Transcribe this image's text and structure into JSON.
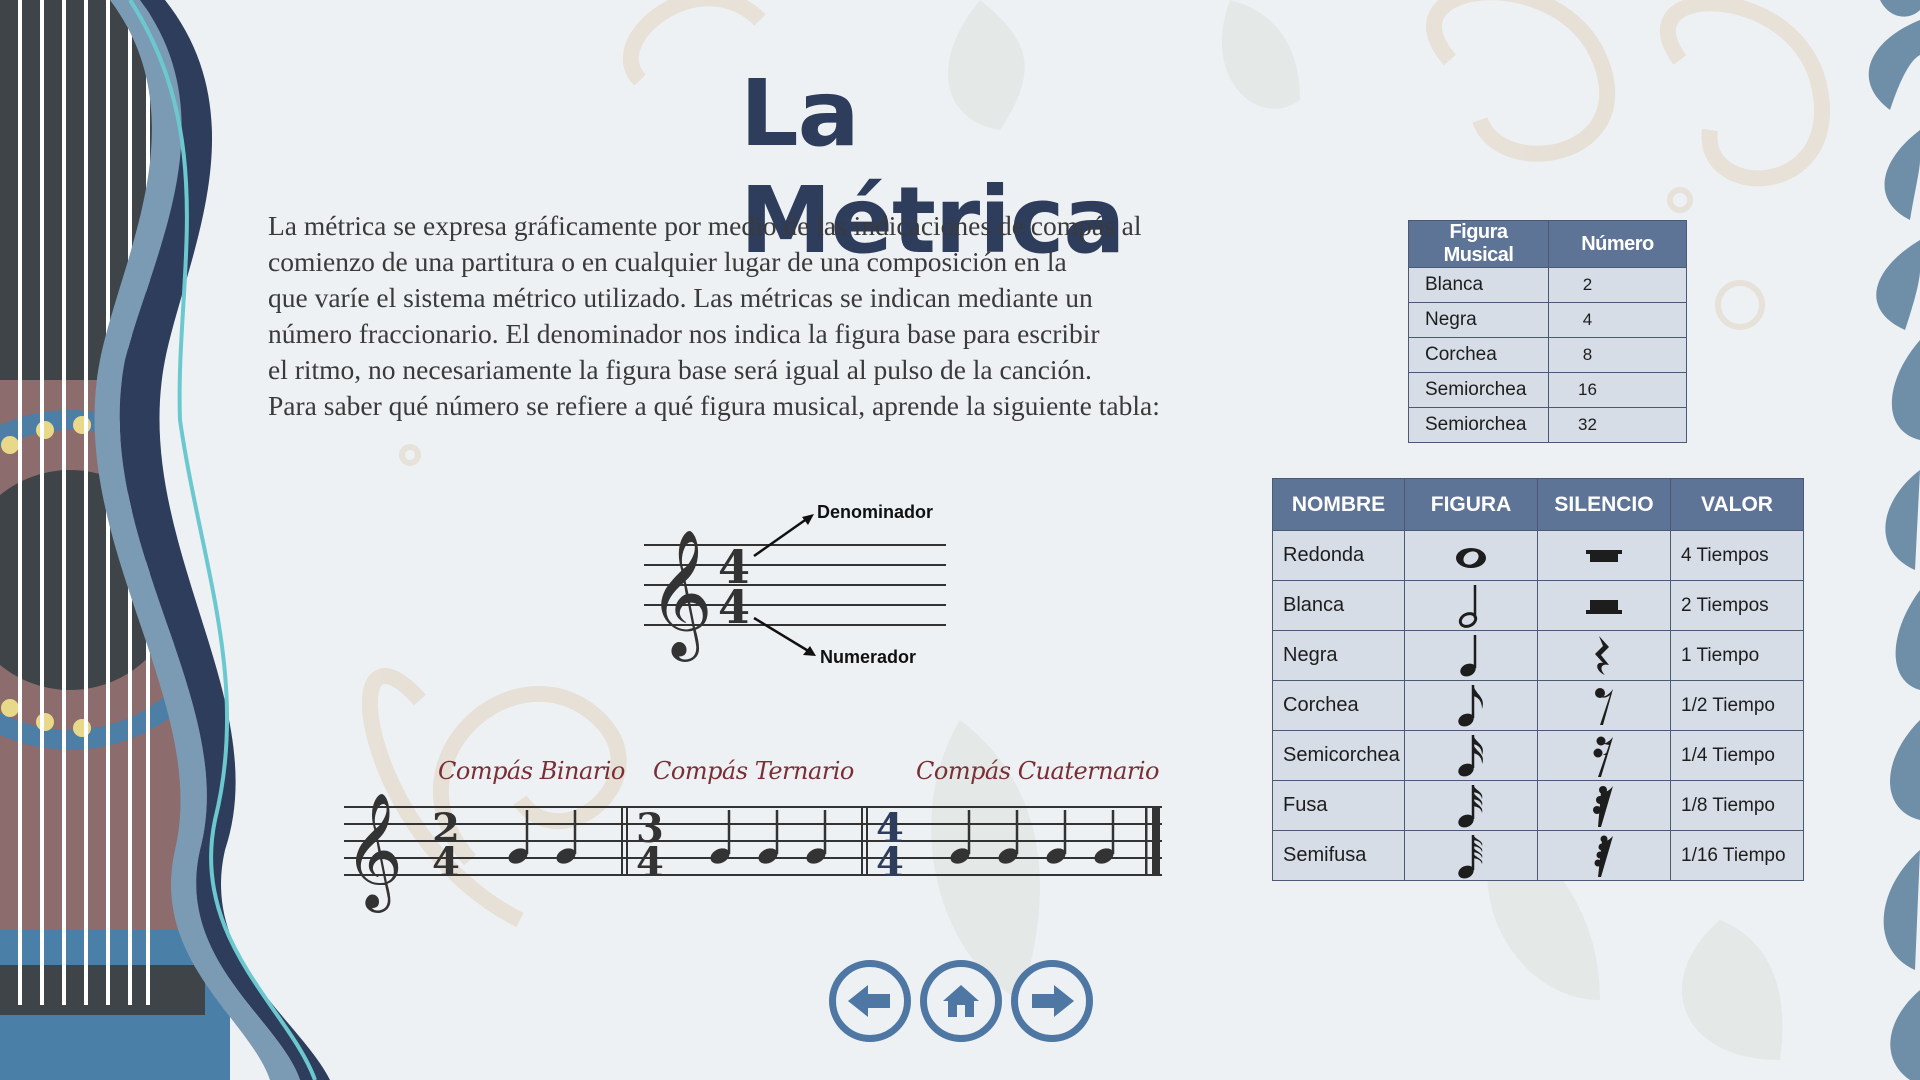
{
  "slide": {
    "title": "La Métrica",
    "intro_lines": [
      "La métrica se expresa gráficamente por medio de las indicaciones de compás al",
      "comienzo de una partitura o en cualquier lugar de una  composición en la",
      "que varíe el sistema métrico utilizado. Las métricas se indican mediante un",
      "número fraccionario. El denominador  nos indica la figura base para escribir",
      "el ritmo, no necesariamente la figura base será igual al pulso de la canción.",
      "Para saber qué  número se refiere a qué figura musical, aprende la siguiente tabla:"
    ]
  },
  "small_table": {
    "headers": [
      "Figura Musical",
      "Número"
    ],
    "rows": [
      [
        "Blanca",
        "2"
      ],
      [
        "Negra",
        "4"
      ],
      [
        "Corchea",
        "8"
      ],
      [
        "Semiorchea",
        "16"
      ],
      [
        "Semiorchea",
        "32"
      ]
    ]
  },
  "big_table": {
    "headers": [
      "NOMBRE",
      "FIGURA",
      "SILENCIO",
      "VALOR"
    ],
    "rows": [
      {
        "name": "Redonda",
        "figure_icon": "whole-note-icon",
        "rest_icon": "whole-rest-icon",
        "value": "4 Tiempos"
      },
      {
        "name": "Blanca",
        "figure_icon": "half-note-icon",
        "rest_icon": "half-rest-icon",
        "value": "2 Tiempos"
      },
      {
        "name": "Negra",
        "figure_icon": "quarter-note-icon",
        "rest_icon": "quarter-rest-icon",
        "value": "1 Tiempo"
      },
      {
        "name": "Corchea",
        "figure_icon": "eighth-note-icon",
        "rest_icon": "eighth-rest-icon",
        "value": "1/2 Tiempo"
      },
      {
        "name": "Semicorchea",
        "figure_icon": "sixteenth-note-icon",
        "rest_icon": "sixteenth-rest-icon",
        "value": "1/4 Tiempo"
      },
      {
        "name": "Fusa",
        "figure_icon": "thirtysecond-note-icon",
        "rest_icon": "thirtysecond-rest-icon",
        "value": "1/8 Tiempo"
      },
      {
        "name": "Semifusa",
        "figure_icon": "sixtyfourth-note-icon",
        "rest_icon": "sixtyfourth-rest-icon",
        "value": "1/16 Tiempo"
      }
    ]
  },
  "diagram": {
    "denominator_label": "Denominador",
    "numerator_label": "Numerador",
    "time_top": "4",
    "time_bottom": "4"
  },
  "compases": {
    "binario": "Compás Binario",
    "ternario": "Compás Ternario",
    "cuaternario": "Compás Cuaternario",
    "binario_sig": [
      "2",
      "4"
    ],
    "ternario_sig": [
      "3",
      "4"
    ],
    "cuaternario_sig": [
      "4",
      "4"
    ]
  },
  "nav": {
    "prev_icon": "arrow-left-icon",
    "home_icon": "home-icon",
    "next_icon": "arrow-right-icon"
  },
  "colors": {
    "title": "#2e3d5c",
    "table_header": "#5e7496",
    "table_cell": "#d6dde6",
    "compas_label": "#7a2f36",
    "nav_ring": "#4f77a3"
  }
}
